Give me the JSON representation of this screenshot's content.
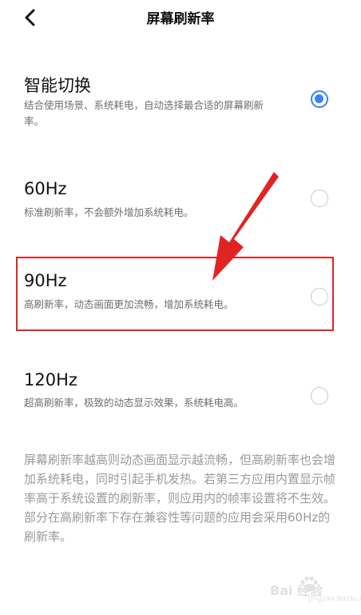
{
  "header": {
    "title": "屏幕刷新率",
    "back_icon": "chevron-left-icon"
  },
  "options": [
    {
      "title": "智能切换",
      "desc": "结合使用场景、系统耗电，自动选择最合适的屏幕刷新率。",
      "selected": true
    },
    {
      "title": "60Hz",
      "desc": "标准刷新率，不会额外增加系统耗电。",
      "selected": false
    },
    {
      "title": "90Hz",
      "desc": "高刷新率，动态画面更加流畅，增加系统耗电。",
      "selected": false
    },
    {
      "title": "120Hz",
      "desc": "超高刷新率，极致的动态显示效果，系统耗电高。",
      "selected": false
    }
  ],
  "footnote": "屏幕刷新率越高则动态画面显示越流畅，但高刷新率也会增加系统耗电，同时引起手机发热。若第三方应用内置显示帧率高于系统设置的刷新率，则应用内的帧率设置将不生效。部分在高刷新率下存在兼容性等问题的应用会采用60Hz的刷新率。",
  "watermark": {
    "text": "Bai 经验",
    "sub": "jingyan.baidu.com"
  },
  "colors": {
    "accent": "#3a82f6",
    "annotation": "#e02424"
  }
}
